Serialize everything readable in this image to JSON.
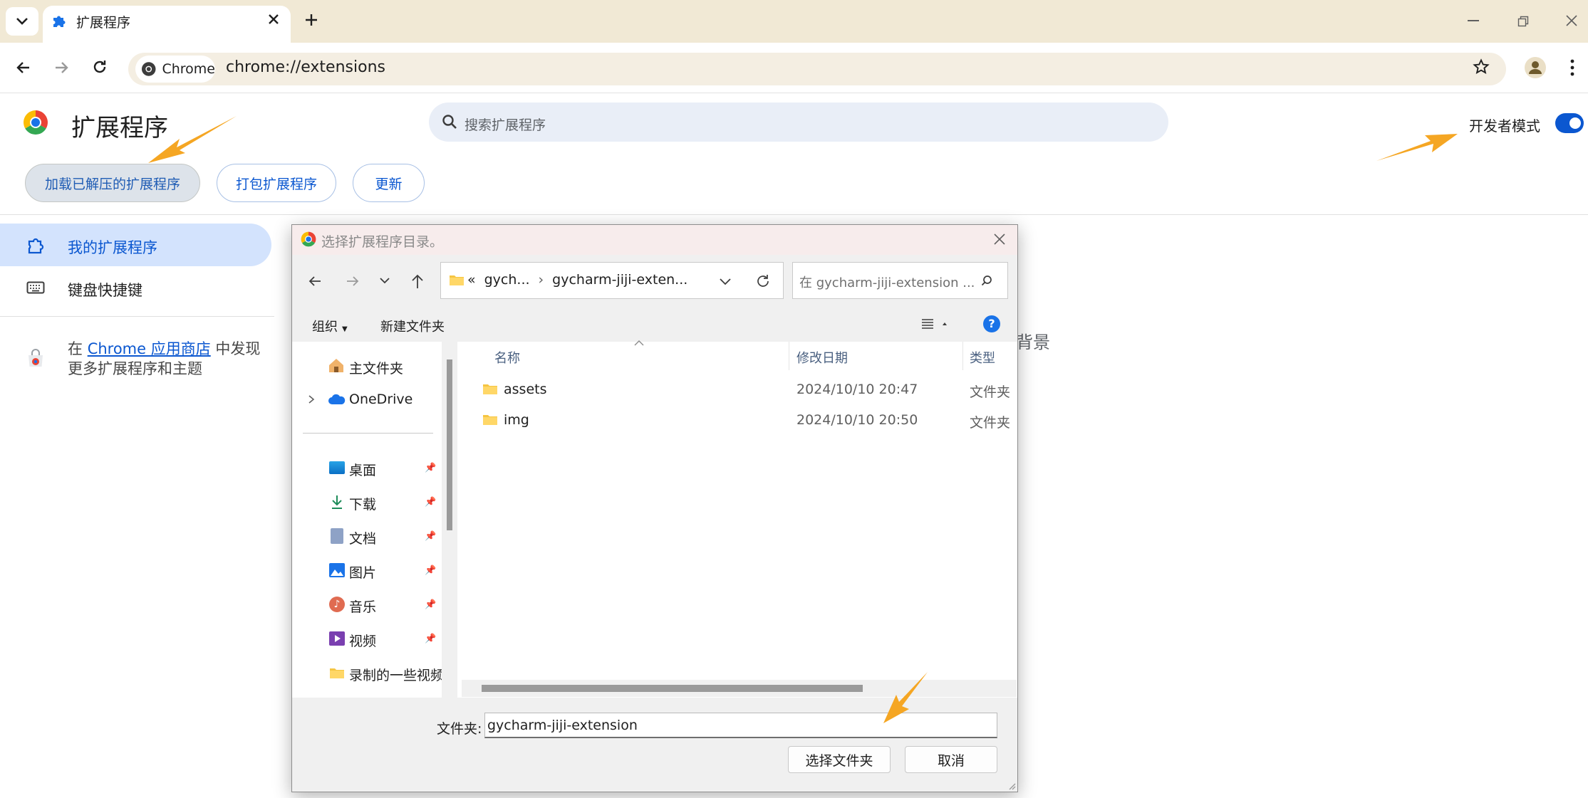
{
  "browser": {
    "tab_title": "扩展程序",
    "chip_label": "Chrome",
    "url": "chrome://extensions"
  },
  "page": {
    "title": "扩展程序",
    "search_placeholder": "搜索扩展程序",
    "dev_mode_label": "开发者模式",
    "dev_mode_on": true,
    "buttons": {
      "load": "加载已解压的扩展程序",
      "pack": "打包扩展程序",
      "update": "更新"
    },
    "nav": {
      "my_extensions": "我的扩展程序",
      "shortcuts": "键盘快捷键"
    },
    "store": {
      "prefix": "在 ",
      "link": "Chrome 应用商店",
      "suffix": " 中发现更多扩展程序和主题"
    },
    "behind_text": "背景"
  },
  "dialog": {
    "title": "选择扩展程序目录。",
    "address": {
      "overflow": "«",
      "crumb1": "gych...",
      "crumb2": "gycharm-jiji-exten..."
    },
    "search_placeholder": "在 gycharm-jiji-extension ...",
    "commands": {
      "organize": "组织",
      "new_folder": "新建文件夹"
    },
    "columns": {
      "name": "名称",
      "date": "修改日期",
      "type": "类型"
    },
    "files": [
      {
        "name": "assets",
        "date": "2024/10/10 20:47",
        "type": "文件夹"
      },
      {
        "name": "img",
        "date": "2024/10/10 20:50",
        "type": "文件夹"
      }
    ],
    "nav": {
      "home": "主文件夹",
      "onedrive": "OneDrive",
      "desktop": "桌面",
      "downloads": "下载",
      "documents": "文档",
      "pictures": "图片",
      "music": "音乐",
      "videos": "视频",
      "recorded": "录制的一些视频"
    },
    "folder_label": "文件夹:",
    "folder_value": "gycharm-jiji-extension",
    "select_button": "选择文件夹",
    "cancel_button": "取消"
  },
  "colors": {
    "accent": "#0b57d0",
    "arrow": "#f5a623"
  }
}
